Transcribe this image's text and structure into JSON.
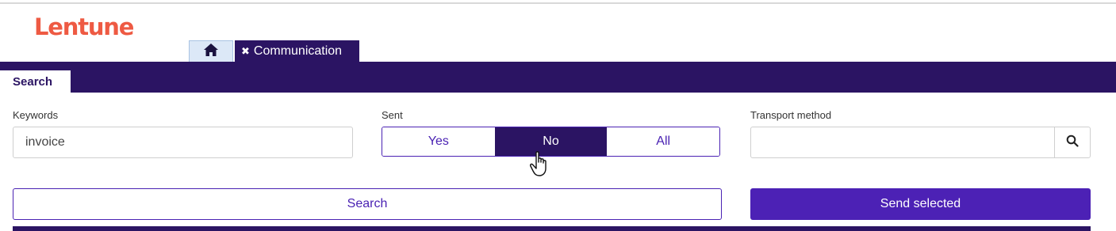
{
  "brand": {
    "logo_text": "Lentune",
    "logo_color": "#ee5a43"
  },
  "tabs": [
    {
      "icon": "home-icon"
    },
    {
      "close_glyph": "✖",
      "label": "Communication"
    }
  ],
  "section_tab": {
    "label": "Search"
  },
  "filters": {
    "keywords": {
      "label": "Keywords",
      "value": "invoice"
    },
    "sent": {
      "label": "Sent",
      "options": [
        "Yes",
        "No",
        "All"
      ],
      "selected": "No"
    },
    "transport": {
      "label": "Transport method",
      "value": "",
      "search_icon": "search-icon"
    }
  },
  "actions": {
    "search_label": "Search",
    "send_label": "Send selected"
  },
  "colors": {
    "primary_dark": "#2b1463",
    "primary": "#4c21b5",
    "accent": "#ee5a43"
  }
}
